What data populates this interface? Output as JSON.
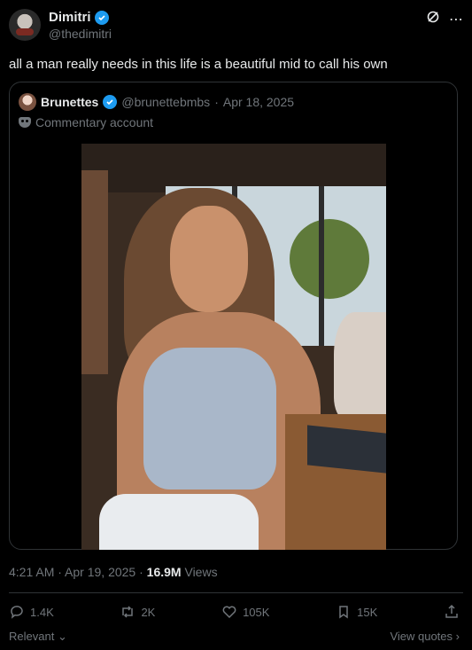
{
  "author": {
    "name": "Dimitri",
    "handle": "@thedimitri"
  },
  "tweet": {
    "text": "all a man really needs in this life is a beautiful mid to call his own"
  },
  "quoted": {
    "name": "Brunettes",
    "handle": "@brunettebmbs",
    "separator": " · ",
    "date": "Apr 18, 2025",
    "label": "Commentary account"
  },
  "meta": {
    "time": "4:21 AM",
    "date": "Apr 19, 2025",
    "views_count": "16.9M",
    "views_label": "Views"
  },
  "actions": {
    "replies": "1.4K",
    "reposts": "2K",
    "likes": "105K",
    "bookmarks": "15K"
  },
  "footer": {
    "relevant": "Relevant",
    "view_quotes": "View quotes"
  },
  "colors": {
    "accent": "#1d9bf0",
    "muted": "#71767b",
    "border": "#2f3336"
  }
}
